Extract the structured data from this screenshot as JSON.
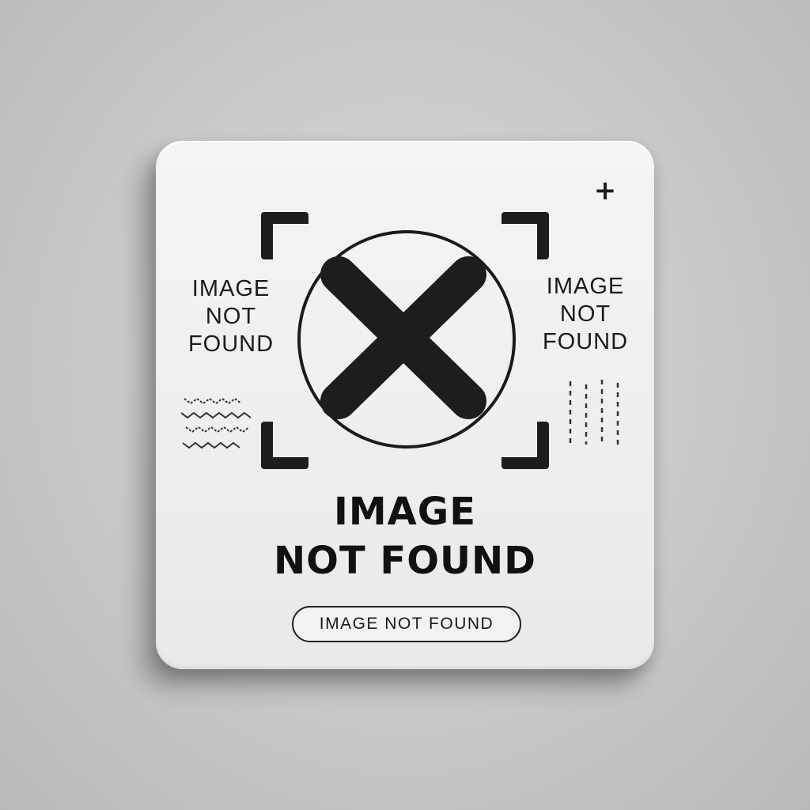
{
  "card": {
    "plus_symbol": "+",
    "side_left_text": "IMAGE\nNOT\nFOUND",
    "side_right_text": "IMAGE\nNOT\nFOUND",
    "title_line1": "IMAGE",
    "title_line2": "NOT FOUND",
    "pill_label": "IMAGE NOT FOUND",
    "icons": {
      "center": "x-circle-icon",
      "corners": "viewfinder-corner-icon",
      "left_pattern": "zigzag-pattern-icon",
      "right_pattern": "dashed-lines-pattern-icon"
    }
  },
  "colors": {
    "background": "#c8c8c8",
    "card": "#efefef",
    "ink": "#1b1b1b"
  }
}
